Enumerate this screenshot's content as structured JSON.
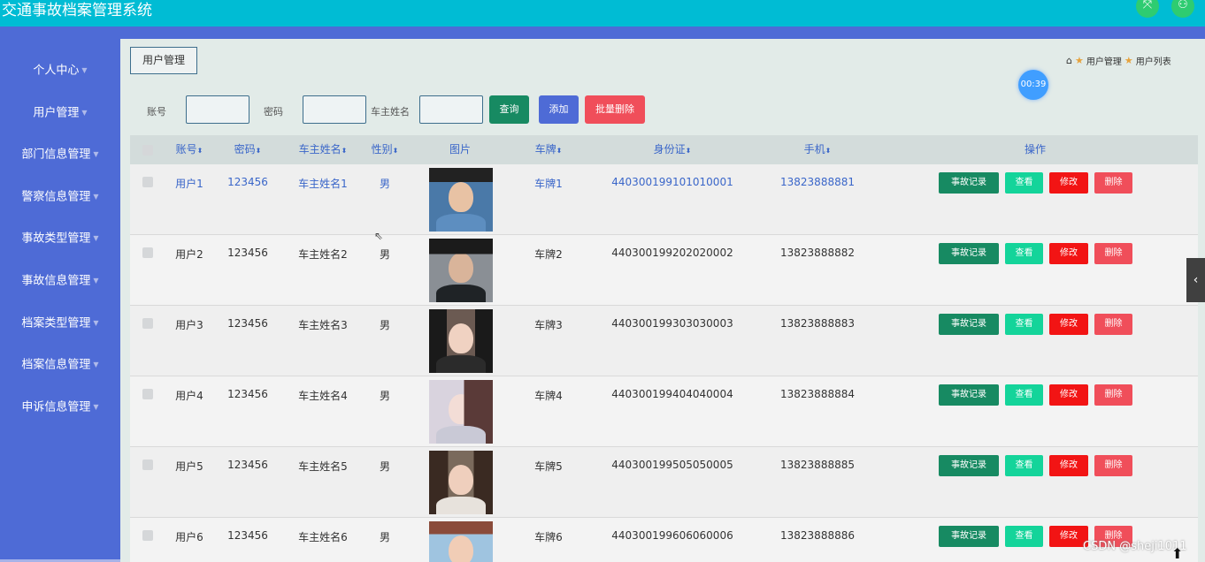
{
  "app": {
    "title": "交通事故档案管理系统"
  },
  "header_icons": [
    {
      "icon": "fullscreen-icon",
      "glyph": "⤧"
    },
    {
      "icon": "user-icon",
      "glyph": "⚇"
    }
  ],
  "sidebar": {
    "items": [
      {
        "label": "个人中心"
      },
      {
        "label": "用户管理"
      },
      {
        "label": "部门信息管理"
      },
      {
        "label": "警察信息管理"
      },
      {
        "label": "事故类型管理"
      },
      {
        "label": "事故信息管理"
      },
      {
        "label": "档案类型管理"
      },
      {
        "label": "档案信息管理"
      },
      {
        "label": "申诉信息管理"
      }
    ]
  },
  "page_tab": "用户管理",
  "breadcrumb": {
    "items": [
      "用户管理",
      "用户列表"
    ]
  },
  "timer": "00:39",
  "search": {
    "account_label": "账号",
    "account_value": "",
    "password_label": "密码",
    "password_value": "",
    "owner_label": "车主姓名",
    "owner_value": "",
    "query_button": "查询",
    "add_button": "添加",
    "batch_delete_button": "批量删除"
  },
  "colors": {
    "topbar": "#00bcd4",
    "sidebar": "#4e6bd6",
    "query": "#178a62",
    "add": "#4e6bd6",
    "batch_delete": "#f04e5a",
    "accident_record": "#178a62",
    "view": "#14d49a",
    "edit": "#f21414",
    "delete": "#f04e5a",
    "header_text": "#3a66c9"
  },
  "table": {
    "headers": [
      "账号",
      "密码",
      "车主姓名",
      "性别",
      "图片",
      "车牌",
      "身份证",
      "手机",
      "操作"
    ],
    "rows": [
      {
        "account": "用户1",
        "password": "123456",
        "owner": "车主姓名1",
        "gender": "男",
        "plate": "车牌1",
        "id_card": "440300199101010001",
        "phone": "13823888881"
      },
      {
        "account": "用户2",
        "password": "123456",
        "owner": "车主姓名2",
        "gender": "男",
        "plate": "车牌2",
        "id_card": "440300199202020002",
        "phone": "13823888882"
      },
      {
        "account": "用户3",
        "password": "123456",
        "owner": "车主姓名3",
        "gender": "男",
        "plate": "车牌3",
        "id_card": "440300199303030003",
        "phone": "13823888883"
      },
      {
        "account": "用户4",
        "password": "123456",
        "owner": "车主姓名4",
        "gender": "男",
        "plate": "车牌4",
        "id_card": "440300199404040004",
        "phone": "13823888884"
      },
      {
        "account": "用户5",
        "password": "123456",
        "owner": "车主姓名5",
        "gender": "男",
        "plate": "车牌5",
        "id_card": "440300199505050005",
        "phone": "13823888885"
      },
      {
        "account": "用户6",
        "password": "123456",
        "owner": "车主姓名6",
        "gender": "男",
        "plate": "车牌6",
        "id_card": "440300199606060006",
        "phone": "13823888886"
      }
    ],
    "actions": {
      "accident_record": "事故记录",
      "view": "查看",
      "edit": "修改",
      "delete": "删除"
    }
  },
  "watermark": "CSDN @sheji1011"
}
